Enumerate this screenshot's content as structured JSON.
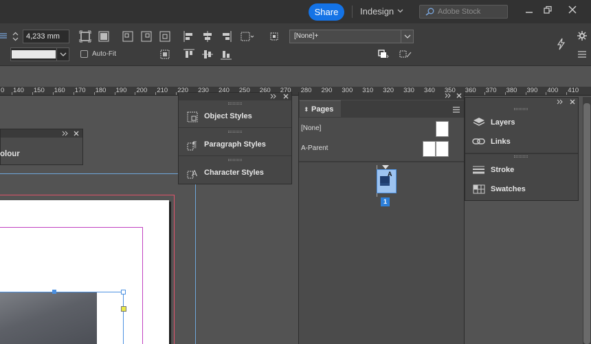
{
  "titlebar": {
    "share_label": "Share",
    "workspace_label": "Indesign",
    "stock_placeholder": "Adobe Stock"
  },
  "controlbar": {
    "stroke_weight": "4,233 mm",
    "autofit_label": "Auto-Fit",
    "object_style_value": "[None]+"
  },
  "ruler": {
    "labels": [
      "0",
      "140",
      "150",
      "160",
      "170",
      "180",
      "190",
      "200",
      "210",
      "220",
      "230",
      "240",
      "250",
      "260",
      "270",
      "280",
      "290",
      "300",
      "310",
      "320",
      "330",
      "340",
      "350",
      "360",
      "370",
      "380",
      "390",
      "400",
      "410"
    ]
  },
  "colour_panel": {
    "label": "olour"
  },
  "styles_panel": {
    "items": [
      {
        "label": "Object Styles",
        "icon": "object-styles-icon"
      },
      {
        "label": "Paragraph Styles",
        "icon": "paragraph-styles-icon"
      },
      {
        "label": "Character Styles",
        "icon": "character-styles-icon"
      }
    ]
  },
  "pages_panel": {
    "tab_label": "Pages",
    "parents": [
      {
        "label": "[None]"
      },
      {
        "label": "A-Parent"
      }
    ],
    "page_prefix": "A",
    "page_number": "1"
  },
  "right_panel": {
    "items": [
      {
        "label": "Layers",
        "icon": "layers-icon"
      },
      {
        "label": "Links",
        "icon": "links-icon"
      },
      {
        "label": "Stroke",
        "icon": "stroke-icon"
      },
      {
        "label": "Swatches",
        "icon": "swatches-icon"
      }
    ]
  },
  "colors": {
    "accent": "#1473e6",
    "selection": "#4a90e2",
    "margin": "#c040c0",
    "bleed": "#e2536b"
  }
}
